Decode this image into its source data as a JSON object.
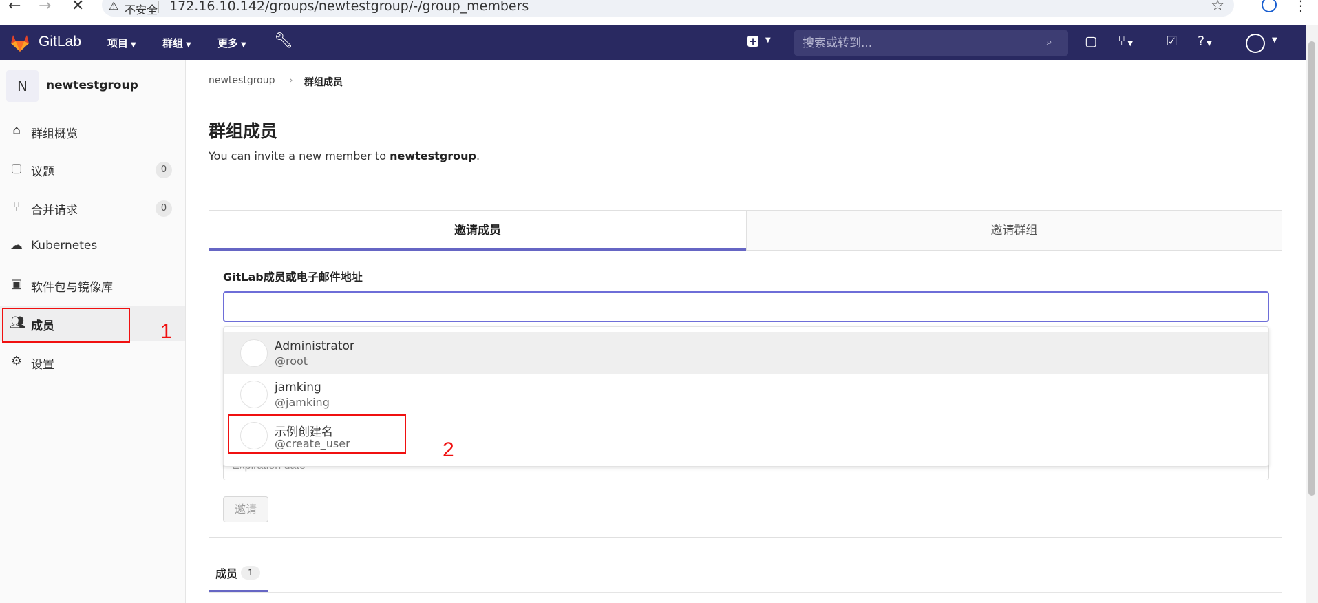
{
  "browser": {
    "security_label": "不安全",
    "url": "172.16.10.142/groups/newtestgroup/-/group_members"
  },
  "topnav": {
    "brand": "GitLab",
    "items": [
      {
        "label": "项目"
      },
      {
        "label": "群组"
      },
      {
        "label": "更多"
      }
    ],
    "search_placeholder": "搜索或转到..."
  },
  "sidebar": {
    "group_initial": "N",
    "group_name": "newtestgroup",
    "items": [
      {
        "label": "群组概览",
        "icon": "home-icon"
      },
      {
        "label": "议题",
        "icon": "issues-icon",
        "count": "0"
      },
      {
        "label": "合并请求",
        "icon": "merge-request-icon",
        "count": "0"
      },
      {
        "label": "Kubernetes",
        "icon": "cloud-icon"
      },
      {
        "label": "软件包与镜像库",
        "icon": "package-icon"
      },
      {
        "label": "成员",
        "icon": "users-icon",
        "active": true
      },
      {
        "label": "设置",
        "icon": "gear-icon"
      }
    ]
  },
  "breadcrumb": {
    "group": "newtestgroup",
    "current": "群组成员"
  },
  "page": {
    "title": "群组成员",
    "invite_prefix": "You can invite a new member to ",
    "invite_group": "newtestgroup",
    "invite_suffix": "."
  },
  "invite_card": {
    "tab_member": "邀请成员",
    "tab_group": "邀请群组",
    "field_label": "GitLab成员或电子邮件地址",
    "expiration_placeholder": "Expiration date",
    "invite_button": "邀请"
  },
  "dropdown": {
    "users": [
      {
        "name": "Administrator",
        "username": "@root"
      },
      {
        "name": "jamking",
        "username": "@jamking"
      },
      {
        "name": "示例创建名",
        "username": "@create_user"
      }
    ]
  },
  "members_tab": {
    "label": "成员",
    "count": "1"
  },
  "annotations": {
    "marker_1": "1",
    "marker_2": "2",
    "color": "#f01010"
  },
  "colors": {
    "navbar": "#292961",
    "accent": "#6666c4"
  }
}
